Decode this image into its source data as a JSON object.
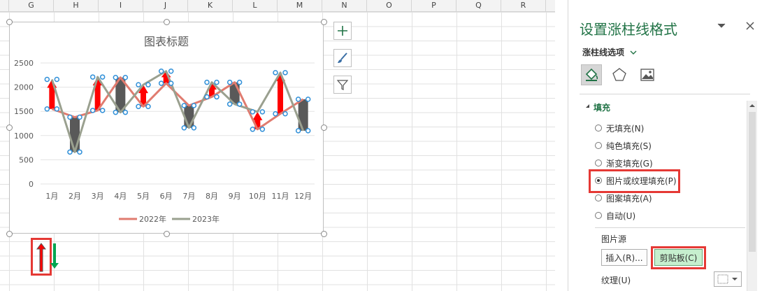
{
  "columns": [
    "G",
    "H",
    "I",
    "J",
    "K",
    "L",
    "M",
    "N",
    "O",
    "P",
    "Q",
    "R"
  ],
  "chart": {
    "title": "图表标题"
  },
  "chart_data": {
    "type": "line",
    "title": "图表标题",
    "categories": [
      "1月",
      "2月",
      "3月",
      "4月",
      "5月",
      "6月",
      "7月",
      "8月",
      "9月",
      "10月",
      "11月",
      "12月"
    ],
    "ylim": [
      0,
      2500
    ],
    "yticks": [
      0,
      500,
      1000,
      1500,
      2000,
      2500
    ],
    "legend_position": "bottom",
    "grid": true,
    "series": [
      {
        "name": "2022年",
        "color": "#e07b6f",
        "values": [
          1550,
          1380,
          1520,
          2200,
          1600,
          2080,
          1620,
          1800,
          2100,
          1130,
          1450,
          1750
        ]
      },
      {
        "name": "2023年",
        "color": "#9aa08f",
        "values": [
          2160,
          660,
          2210,
          1480,
          2050,
          2330,
          1160,
          2100,
          1650,
          1490,
          2300,
          1100
        ]
      }
    ],
    "updown_bars": {
      "up_color": "#ff0000",
      "down_color": "#595959"
    }
  },
  "pane": {
    "title": "设置涨柱线格式",
    "subtitle": "涨柱线选项",
    "section": "填充",
    "options": [
      {
        "label": "无填充(N)",
        "checked": false
      },
      {
        "label": "纯色填充(S)",
        "checked": false
      },
      {
        "label": "渐变填充(G)",
        "checked": false
      },
      {
        "label": "图片或纹理填充(P)",
        "checked": true
      },
      {
        "label": "图案填充(A)",
        "checked": false
      },
      {
        "label": "自动(U)",
        "checked": false
      }
    ],
    "picture_source": "图片源",
    "insert_btn": "插入(R)...",
    "clipboard_btn": "剪贴板(C)",
    "texture": "纹理(U)"
  },
  "colors": {
    "accent": "#217346",
    "highlight": "#e53935",
    "up": "#ff0000",
    "down_arrow": "#00a651"
  }
}
